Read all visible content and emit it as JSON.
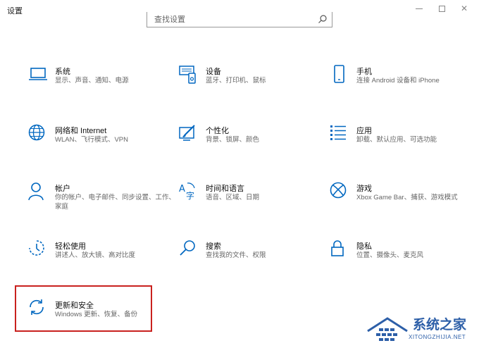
{
  "window": {
    "title": "设置"
  },
  "search": {
    "placeholder": "查找设置"
  },
  "tiles": [
    {
      "name": "系统",
      "desc": "显示、声音、通知、电源",
      "icon": "laptop-icon"
    },
    {
      "name": "设备",
      "desc": "蓝牙、打印机、鼠标",
      "icon": "devices-icon"
    },
    {
      "name": "手机",
      "desc": "连接 Android 设备和 iPhone",
      "icon": "phone-icon"
    },
    {
      "name": "网络和 Internet",
      "desc": "WLAN、飞行模式、VPN",
      "icon": "globe-icon"
    },
    {
      "name": "个性化",
      "desc": "背景、锁屏、颜色",
      "icon": "personalization-icon"
    },
    {
      "name": "应用",
      "desc": "卸载、默认应用、可选功能",
      "icon": "apps-list-icon"
    },
    {
      "name": "帐户",
      "desc": "你的帐户、电子邮件、同步设置、工作、家庭",
      "icon": "person-icon"
    },
    {
      "name": "时间和语言",
      "desc": "语音、区域、日期",
      "icon": "time-language-icon"
    },
    {
      "name": "游戏",
      "desc": "Xbox Game Bar、捕获、游戏模式",
      "icon": "xbox-icon"
    },
    {
      "name": "轻松使用",
      "desc": "讲述人、放大镜、高对比度",
      "icon": "ease-of-access-icon"
    },
    {
      "name": "搜索",
      "desc": "查找我的文件、权限",
      "icon": "search-icon"
    },
    {
      "name": "隐私",
      "desc": "位置、摄像头、麦克风",
      "icon": "lock-icon"
    },
    {
      "name": "更新和安全",
      "desc": "Windows 更新、恢复、备份",
      "icon": "update-icon"
    }
  ],
  "watermark": {
    "text": "系统之家",
    "url": "XITONGZHIJIA.NET"
  },
  "colors": {
    "accent": "#0067c0",
    "highlight": "#c9211e",
    "watermark": "#2d5fa8"
  }
}
